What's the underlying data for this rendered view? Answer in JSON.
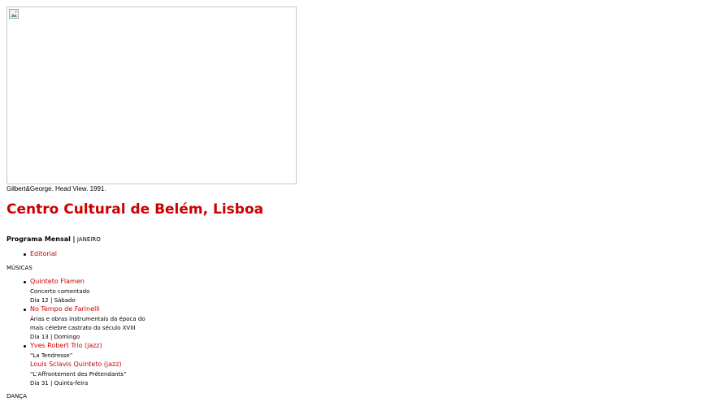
{
  "hero": {
    "caption": "Gilbert&George. Head View. 1991."
  },
  "title": "Centro Cultural de Belém, Lisboa",
  "program": {
    "label": "Programa Mensal",
    "separator": "|",
    "month": "JANEIRO"
  },
  "editorial": {
    "link": "Editorial"
  },
  "sections": {
    "music": "MÚSICAS",
    "dance": "DANÇA"
  },
  "music_items": [
    {
      "title": "Quinteto Flamen",
      "lines": [
        "Concerto comentado",
        "Dia 12 | Sábado"
      ]
    },
    {
      "title": "No Tempo de Farinelli",
      "lines": [
        "Árias e obras instrumentais da época do",
        "mais célebre castrato do século XVIII",
        "Dia 13 | Domingo"
      ]
    },
    {
      "title": "Yves Robert Trio (jazz)",
      "lines": [
        "“La Tendresse”"
      ],
      "extra_title": "Louis Sclavis Quinteto (jazz)",
      "extra_lines": [
        "“L’Affrontement des Prétendants”",
        "Dia 31 | Quinta-feira"
      ]
    }
  ],
  "colors": {
    "accent": "#cc0000",
    "text": "#000000",
    "background": "#ffffff"
  }
}
